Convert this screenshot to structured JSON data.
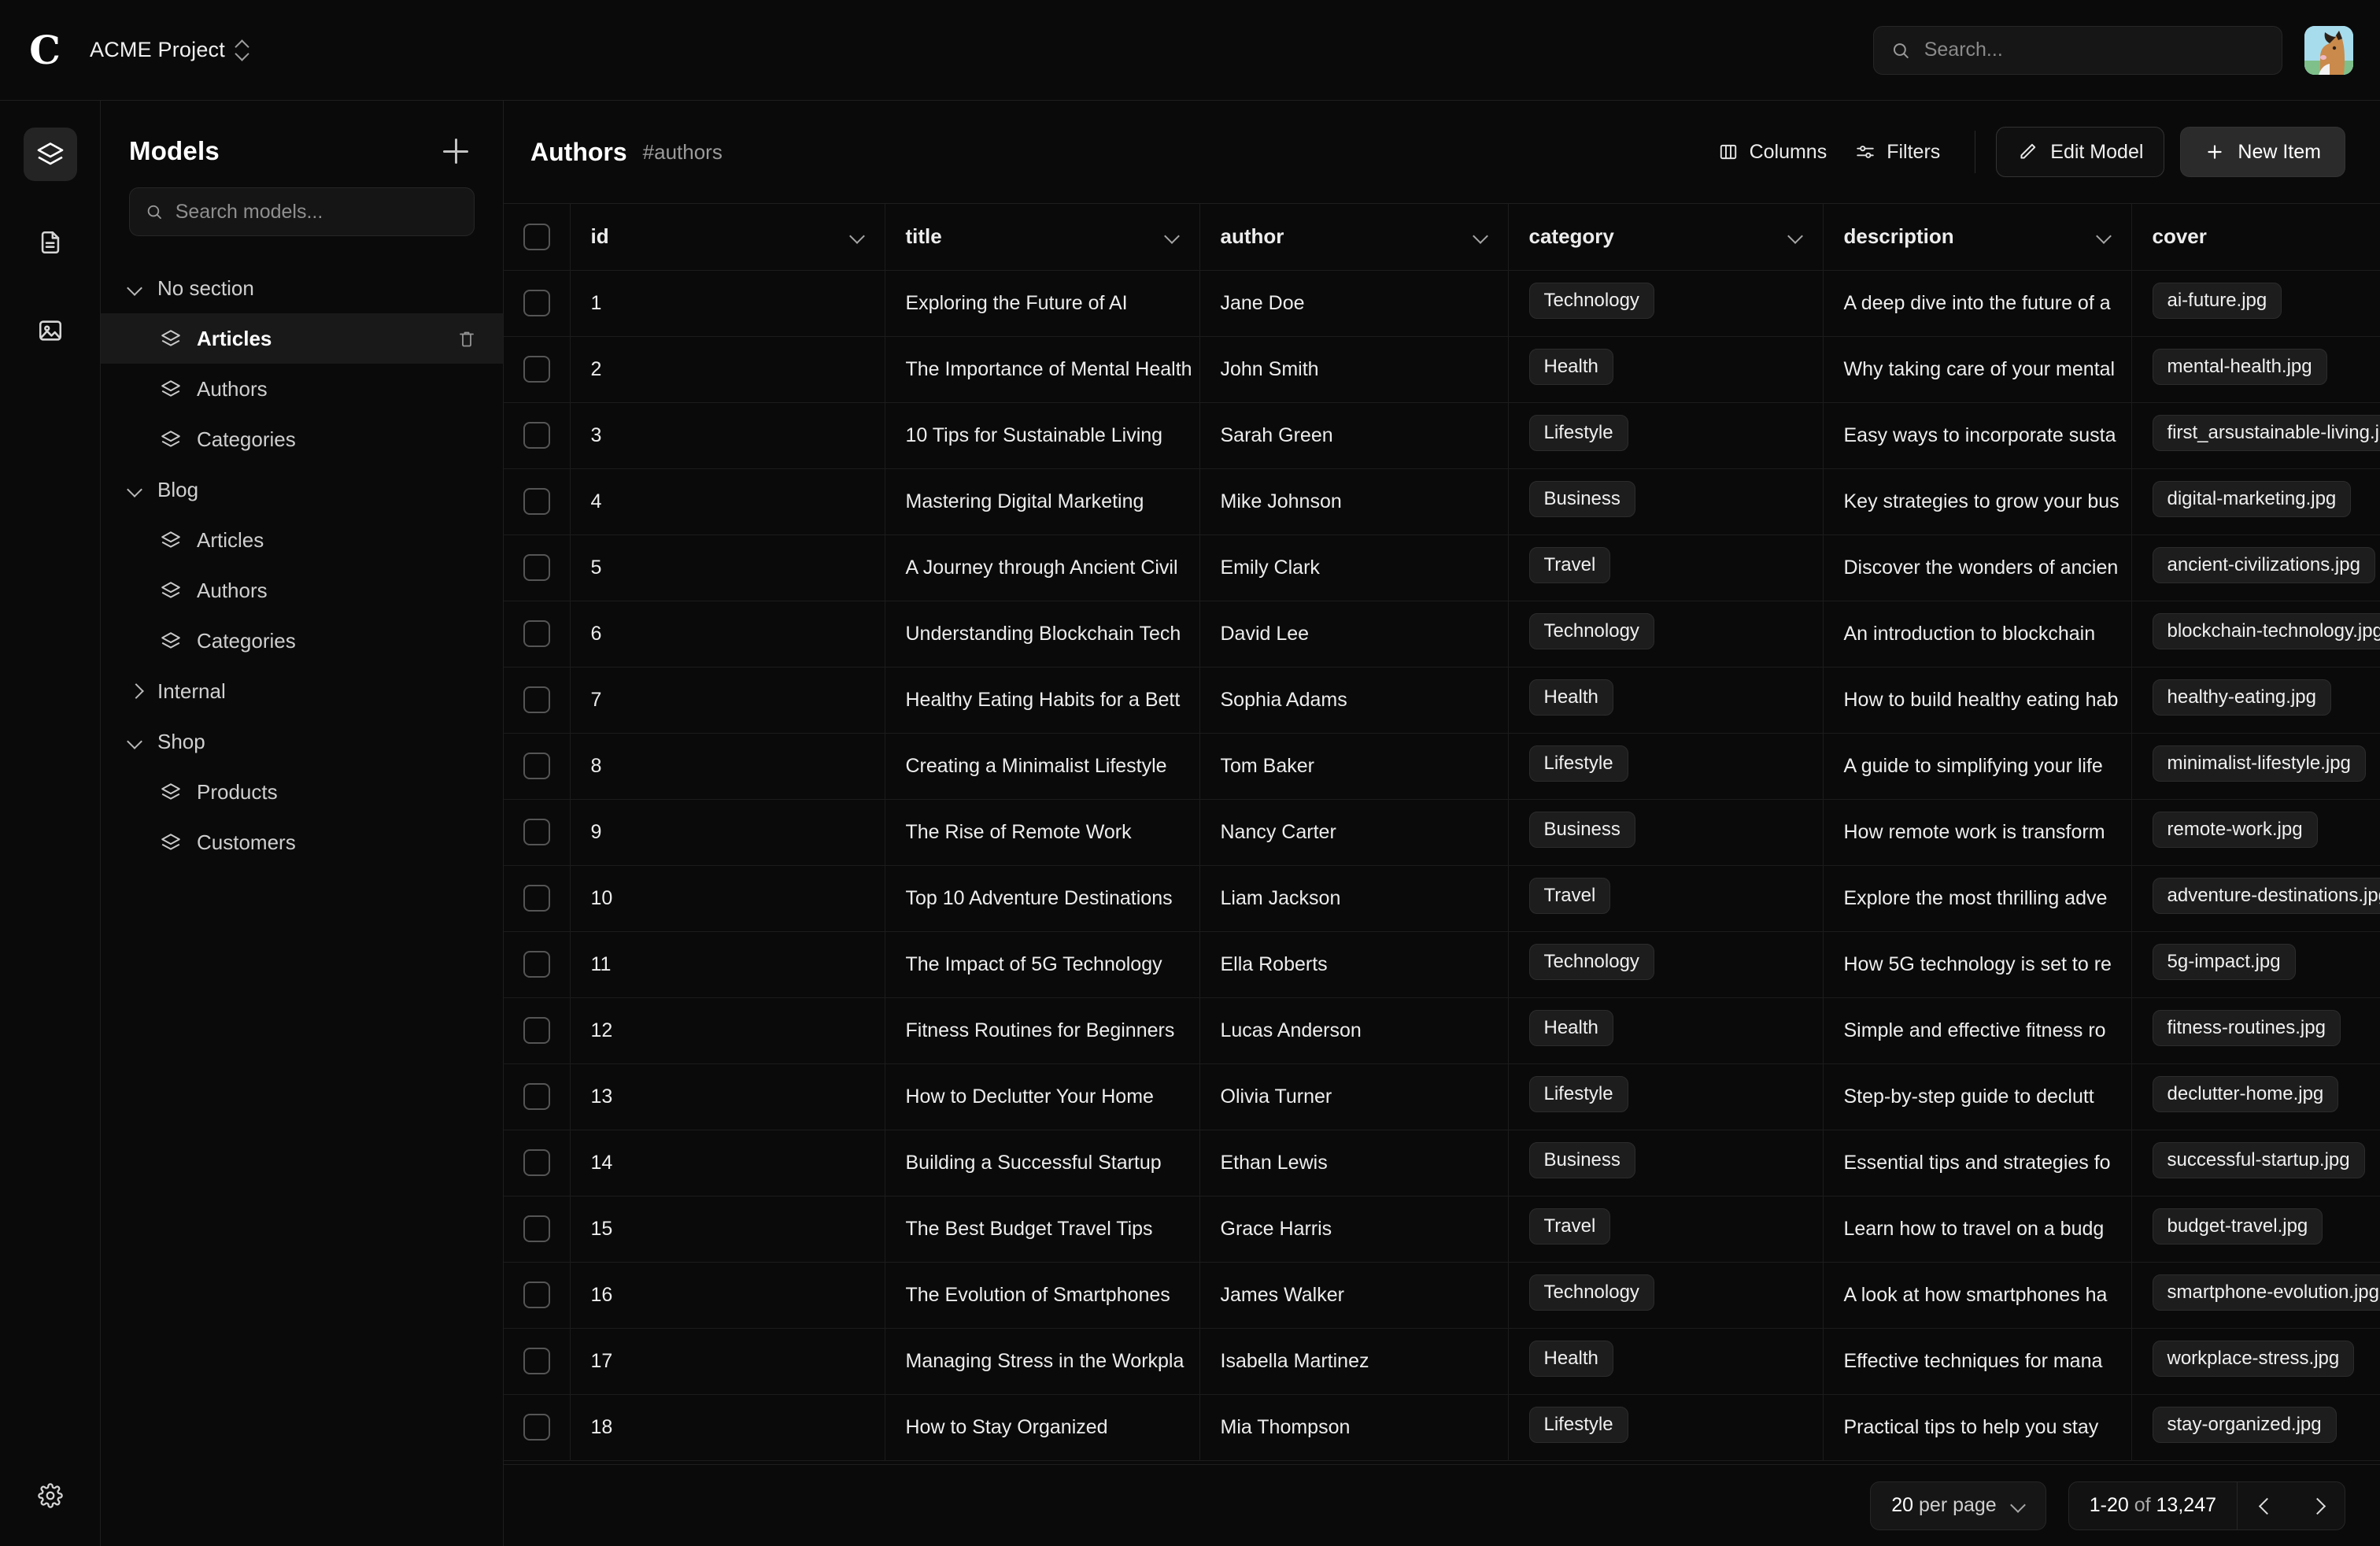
{
  "topbar": {
    "logo_glyph": "C",
    "project_name": "ACME Project",
    "search_placeholder": "Search...",
    "search_value": ""
  },
  "rail": {
    "items": [
      {
        "icon": "layers-icon",
        "active": true
      },
      {
        "icon": "document-icon",
        "active": false
      },
      {
        "icon": "image-icon",
        "active": false
      }
    ],
    "bottom": {
      "icon": "gear-icon"
    }
  },
  "sidebar": {
    "title": "Models",
    "add_label": "+",
    "search_placeholder": "Search models...",
    "search_value": "",
    "sections": [
      {
        "label": "No section",
        "expanded": true,
        "items": [
          {
            "label": "Articles",
            "active": true,
            "deletable": true
          },
          {
            "label": "Authors",
            "active": false,
            "deletable": false
          },
          {
            "label": "Categories",
            "active": false,
            "deletable": false
          }
        ]
      },
      {
        "label": "Blog",
        "expanded": true,
        "items": [
          {
            "label": "Articles",
            "active": false,
            "deletable": false
          },
          {
            "label": "Authors",
            "active": false,
            "deletable": false
          },
          {
            "label": "Categories",
            "active": false,
            "deletable": false
          }
        ]
      },
      {
        "label": "Internal",
        "expanded": false,
        "items": []
      },
      {
        "label": "Shop",
        "expanded": true,
        "items": [
          {
            "label": "Products",
            "active": false,
            "deletable": false
          },
          {
            "label": "Customers",
            "active": false,
            "deletable": false
          }
        ]
      }
    ]
  },
  "main": {
    "title": "Authors",
    "slug": "#authors",
    "toolbar": {
      "columns_label": "Columns",
      "filters_label": "Filters",
      "edit_model_label": "Edit Model",
      "new_item_label": "New Item"
    },
    "columns": [
      {
        "key": "id",
        "label": "id"
      },
      {
        "key": "title",
        "label": "title"
      },
      {
        "key": "author",
        "label": "author"
      },
      {
        "key": "category",
        "label": "category"
      },
      {
        "key": "description",
        "label": "description"
      },
      {
        "key": "cover",
        "label": "cover"
      }
    ],
    "rows": [
      {
        "id": "1",
        "title": "Exploring the Future of AI",
        "author": "Jane Doe",
        "category": "Technology",
        "description": "A deep dive into the future of a",
        "cover": "ai-future.jpg"
      },
      {
        "id": "2",
        "title": "The Importance of Mental Health",
        "author": "John Smith",
        "category": "Health",
        "description": "Why taking care of your mental",
        "cover": "mental-health.jpg"
      },
      {
        "id": "3",
        "title": "10 Tips for Sustainable Living",
        "author": "Sarah Green",
        "category": "Lifestyle",
        "description": "Easy ways to incorporate susta",
        "cover": "first_arsustainable-living.jpg"
      },
      {
        "id": "4",
        "title": "Mastering Digital Marketing",
        "author": "Mike Johnson",
        "category": "Business",
        "description": "Key strategies to grow your bus",
        "cover": "digital-marketing.jpg"
      },
      {
        "id": "5",
        "title": "A Journey through Ancient Civil",
        "author": "Emily Clark",
        "category": "Travel",
        "description": "Discover the wonders of ancien",
        "cover": "ancient-civilizations.jpg"
      },
      {
        "id": "6",
        "title": "Understanding Blockchain Tech",
        "author": "David Lee",
        "category": "Technology",
        "description": "An introduction to blockchain",
        "cover": "blockchain-technology.jpg"
      },
      {
        "id": "7",
        "title": "Healthy Eating Habits for a Bett",
        "author": "Sophia Adams",
        "category": "Health",
        "description": "How to build healthy eating hab",
        "cover": "healthy-eating.jpg"
      },
      {
        "id": "8",
        "title": "Creating a Minimalist Lifestyle",
        "author": "Tom Baker",
        "category": "Lifestyle",
        "description": "A guide to simplifying your life",
        "cover": "minimalist-lifestyle.jpg"
      },
      {
        "id": "9",
        "title": "The Rise of Remote Work",
        "author": "Nancy Carter",
        "category": "Business",
        "description": "How remote work is transform",
        "cover": "remote-work.jpg"
      },
      {
        "id": "10",
        "title": "Top 10 Adventure Destinations",
        "author": "Liam Jackson",
        "category": "Travel",
        "description": "Explore the most thrilling adve",
        "cover": "adventure-destinations.jpg"
      },
      {
        "id": "11",
        "title": "The Impact of 5G Technology",
        "author": "Ella Roberts",
        "category": "Technology",
        "description": "How 5G technology is set to re",
        "cover": "5g-impact.jpg"
      },
      {
        "id": "12",
        "title": "Fitness Routines for Beginners",
        "author": "Lucas Anderson",
        "category": "Health",
        "description": "Simple and effective fitness ro",
        "cover": "fitness-routines.jpg"
      },
      {
        "id": "13",
        "title": "How to Declutter Your Home",
        "author": "Olivia Turner",
        "category": "Lifestyle",
        "description": "Step-by-step guide to declutt",
        "cover": "declutter-home.jpg"
      },
      {
        "id": "14",
        "title": "Building a Successful Startup",
        "author": "Ethan Lewis",
        "category": "Business",
        "description": "Essential tips and strategies fo",
        "cover": "successful-startup.jpg"
      },
      {
        "id": "15",
        "title": "The Best Budget Travel Tips",
        "author": "Grace Harris",
        "category": "Travel",
        "description": "Learn how to travel on a budg",
        "cover": "budget-travel.jpg"
      },
      {
        "id": "16",
        "title": "The Evolution of Smartphones",
        "author": "James Walker",
        "category": "Technology",
        "description": "A look at how smartphones ha",
        "cover": "smartphone-evolution.jpg"
      },
      {
        "id": "17",
        "title": "Managing Stress in the Workpla",
        "author": "Isabella Martinez",
        "category": "Health",
        "description": "Effective techniques for mana",
        "cover": "workplace-stress.jpg"
      },
      {
        "id": "18",
        "title": "How to Stay Organized",
        "author": "Mia Thompson",
        "category": "Lifestyle",
        "description": "Practical tips to help you stay",
        "cover": "stay-organized.jpg"
      }
    ]
  },
  "footer": {
    "per_page_label": "per page",
    "per_page_value": "20",
    "range_label": "1-20",
    "of_label": "of",
    "total_label": "13,247"
  },
  "colors": {
    "background": "#0a0a0a",
    "panel": "#101010",
    "border": "#1e1e1e",
    "chip_bg": "#1d1d1d",
    "text": "#ededed",
    "muted": "#9b9b9b",
    "accent": "#2b2b2b"
  }
}
